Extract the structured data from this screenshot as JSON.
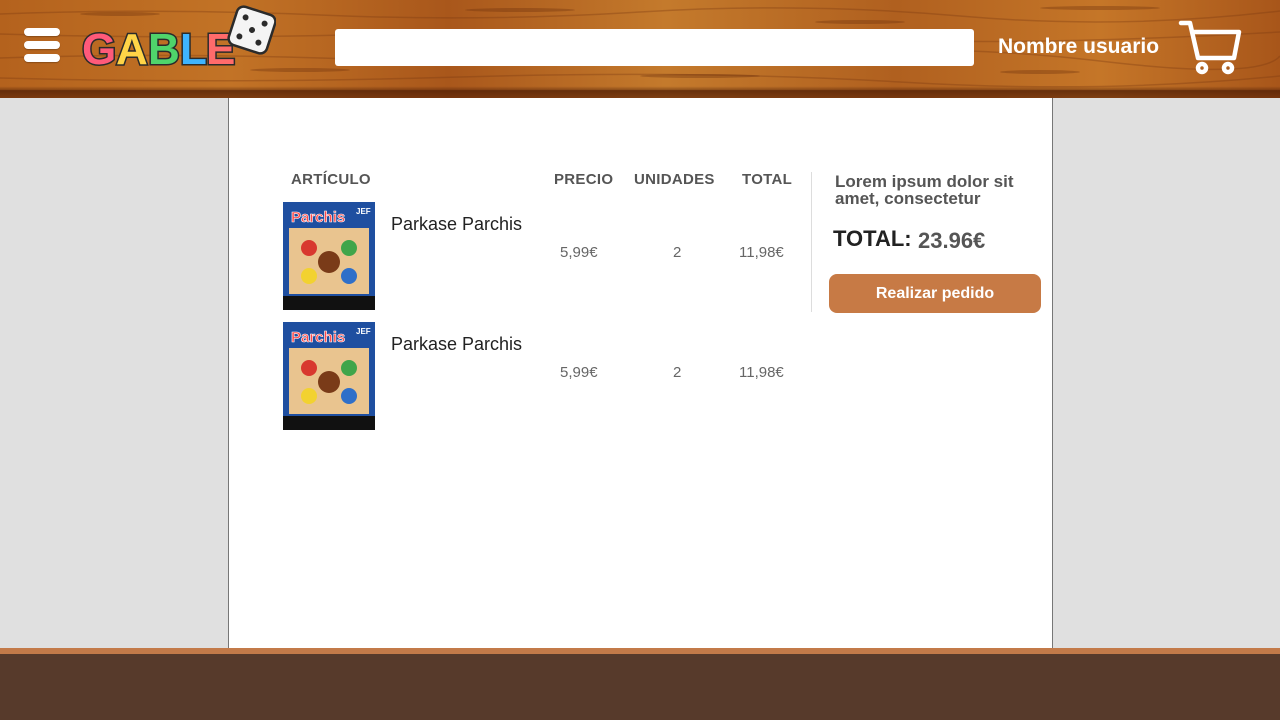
{
  "header": {
    "logo_text": "GABLE",
    "search": {
      "value": "",
      "placeholder": ""
    },
    "username": "Nombre usuario",
    "menu_icon": "hamburger-menu-icon",
    "cart_icon": "shopping-cart-icon"
  },
  "cart_table": {
    "headers": {
      "article": "ARTÍCULO",
      "price": "PRECIO",
      "units": "UNIDADES",
      "total": "TOTAL"
    },
    "items": [
      {
        "name": "Parkase Parchis",
        "price": "5,99€",
        "units": "2",
        "total": "11,98€",
        "image_title": "Parchis",
        "image_brand": "JEF"
      },
      {
        "name": "Parkase Parchis",
        "price": "5,99€",
        "units": "2",
        "total": "11,98€",
        "image_title": "Parchis",
        "image_brand": "JEF"
      }
    ]
  },
  "summary": {
    "text": "Lorem ipsum dolor sit amet, consectetur",
    "total_label": "TOTAL:",
    "total_value": "23.96€",
    "order_button": "Realizar pedido"
  },
  "colors": {
    "header_wood": "#b4621d",
    "accent_button": "#c77a45",
    "footer": "#573a2b",
    "footer_strip": "#c37a49",
    "page_bg": "#e0e0e0"
  }
}
